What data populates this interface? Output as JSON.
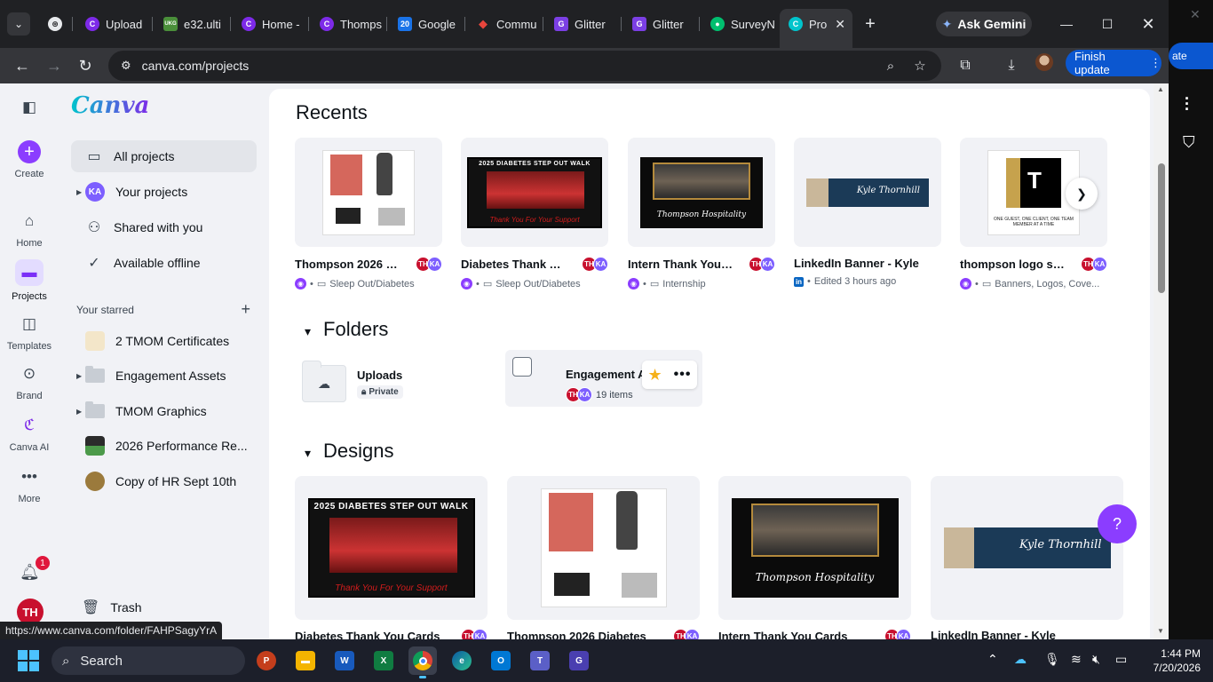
{
  "browser": {
    "tabs": [
      {
        "label": "Upload",
        "favicon": "C",
        "color": "#7d2ae8"
      },
      {
        "label": "e32.ulti",
        "favicon": "UKG",
        "color": "#4a8f3a"
      },
      {
        "label": "Home -",
        "favicon": "C",
        "color": "#7d2ae8"
      },
      {
        "label": "Thomps",
        "favicon": "C",
        "color": "#7d2ae8"
      },
      {
        "label": "Google",
        "favicon": "20",
        "color": "#1a73e8"
      },
      {
        "label": "Commu",
        "favicon": "◆",
        "color": "#e8453c"
      },
      {
        "label": "Glitter",
        "favicon": "G",
        "color": "#7b3fe4"
      },
      {
        "label": "Glitter",
        "favicon": "G",
        "color": "#7b3fe4"
      },
      {
        "label": "SurveyN",
        "favicon": "●",
        "color": "#00bf6f"
      }
    ],
    "active_tab": {
      "label": "Pro",
      "favicon": "C",
      "close": "✕"
    },
    "ask_gemini": "Ask Gemini",
    "url": "canva.com/projects",
    "finish_update": "Finish update",
    "status_url": "https://www.canva.com/folder/FAHPSagyYrA",
    "behind_window_text": "ate"
  },
  "rail": {
    "create": "Create",
    "home": "Home",
    "projects": "Projects",
    "templates": "Templates",
    "brand": "Brand",
    "canva_ai": "Canva AI",
    "more": "More",
    "notification_count": "1",
    "avatar": "TH"
  },
  "sidebar": {
    "logo": "Canva",
    "nav": {
      "all_projects": "All projects",
      "your_projects": "Your projects",
      "shared": "Shared with you",
      "offline": "Available offline"
    },
    "ka": "KA",
    "starred_heading": "Your starred",
    "starred": [
      {
        "label": "2 TMOM Certificates"
      },
      {
        "label": "Engagement Assets"
      },
      {
        "label": "TMOM Graphics"
      },
      {
        "label": "2026 Performance Re..."
      },
      {
        "label": "Copy of HR Sept 10th"
      }
    ],
    "trash": "Trash"
  },
  "main": {
    "recents_title": "Recents",
    "recents": [
      {
        "title": "Thompson 2026 D...",
        "folder": "Sleep Out/Diabetes"
      },
      {
        "title": "Diabetes Thank Yo...",
        "folder": "Sleep Out/Diabetes"
      },
      {
        "title": "Intern Thank You ...",
        "folder": "Internship"
      },
      {
        "title": "LinkedIn Banner - Kyle",
        "folder": "Edited 3 hours ago"
      },
      {
        "title": "thompson logo sti...",
        "folder": "Banners, Logos, Cove..."
      }
    ],
    "folders_title": "Folders",
    "folders": {
      "uploads": "Uploads",
      "private": "Private",
      "engagement": "Engagement A",
      "engagement_count": "19 items"
    },
    "designs_title": "Designs",
    "designs": [
      {
        "title": "Diabetes Thank You Cards"
      },
      {
        "title": "Thompson 2026 Diabetes"
      },
      {
        "title": "Intern Thank You Cards"
      },
      {
        "title": "LinkedIn Banner - Kyle"
      }
    ],
    "avatar_th": "TH",
    "avatar_ka": "KA",
    "help": "?"
  },
  "thumbs": {
    "diabetes_header": "2025 DIABETES STEP OUT WALK",
    "diabetes_footer": "Thank You For Your Support",
    "intern_sig": "Thompson Hospitality",
    "linkedin_sig": "Kyle Thornhill",
    "logo_caption": "ONE GUEST, ONE CLIENT, ONE TEAM MEMBER AT A TIME"
  },
  "taskbar": {
    "search": "Search",
    "time": "1:44 PM",
    "date": "7/20/2026"
  }
}
